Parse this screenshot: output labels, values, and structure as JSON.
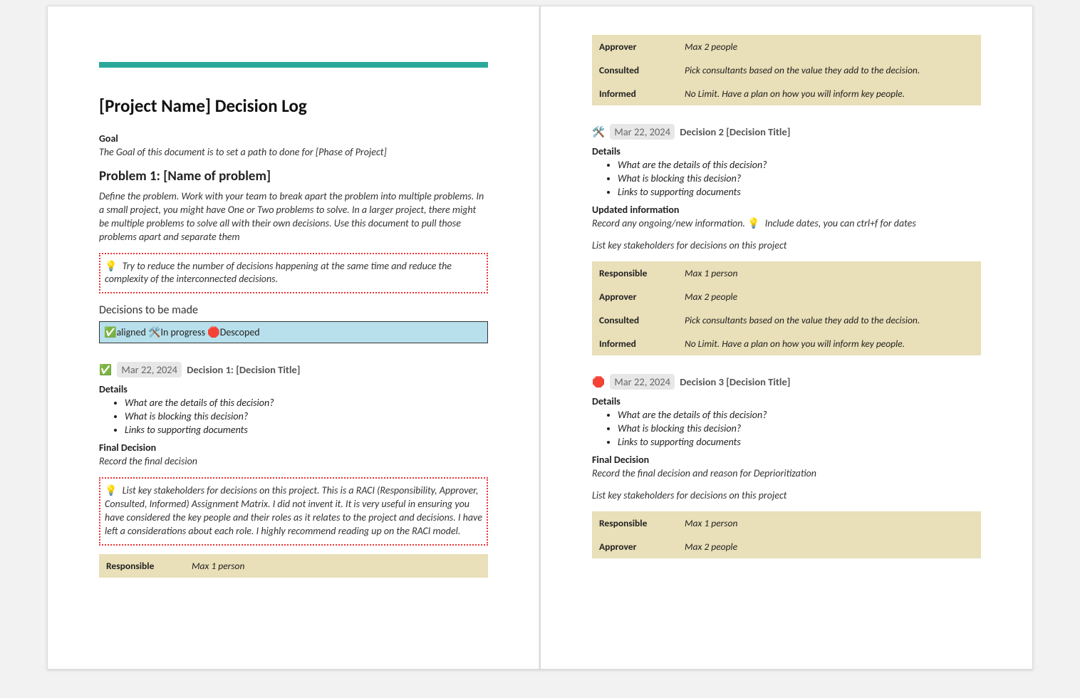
{
  "title": "[Project Name] Decision Log",
  "goal": {
    "heading": "Goal",
    "text": "The Goal of this document is to set a path to done for [Phase of Project]"
  },
  "problem": {
    "heading": "Problem 1: [Name of problem]",
    "text": "Define the problem. Work with your team to break apart the problem into multiple problems. In a small project, you might have One or Two problems to solve. In a larger project, there might be multiple problems to solve all with their own decisions. Use this document to pull those problems apart and separate them"
  },
  "tip1": "Try to reduce the number of decisions happening at the same time and reduce the complexity of the interconnected decisions.",
  "decisions_heading": "Decisions to be made",
  "legend": {
    "aligned": "aligned",
    "inprogress": "In progress",
    "descoped": "Descoped"
  },
  "icons": {
    "check": "✅",
    "tools": "🛠️",
    "stop": "🛑",
    "bulb": "💡"
  },
  "details_heading": "Details",
  "details_items": [
    "What are the details of this decision?",
    "What is blocking this decision?",
    "Links to supporting documents"
  ],
  "final_decision_heading": "Final Decision",
  "updated_info_heading": "Updated information",
  "stakeholders_line": "List key stakeholders for decisions on this project",
  "tip2": "List key stakeholders for decisions on this project. This is a RACI (Responsibility, Approver, Consulted, Informed) Assignment Matrix. I did not invent it. It is very useful in ensuring you have considered the key people and their roles as it relates to the project and decisions. I have left a considerations about each role. I highly recommend reading up on the RACI model.",
  "raci_roles": {
    "responsible": {
      "label": "Responsible",
      "val": "Max 1 person"
    },
    "approver": {
      "label": "Approver",
      "val": "Max 2 people"
    },
    "consulted": {
      "label": "Consulted",
      "val": "Pick consultants based on the value they add to the decision."
    },
    "informed": {
      "label": "Informed",
      "val": "No Limit. Have a plan on how you will inform key people."
    }
  },
  "decisions": {
    "d1": {
      "date": "Mar 22, 2024",
      "title": "Decision 1: [Decision Title]",
      "final_text": "Record the final decision"
    },
    "d2": {
      "date": "Mar 22, 2024",
      "title": "Decision 2 [Decision Title]",
      "updated_text_a": "Record any ongoing/new information.",
      "updated_text_b": "Include dates, you can ctrl+f for dates"
    },
    "d3": {
      "date": "Mar 22, 2024",
      "title": "Decision 3 [Decision Title]",
      "final_text": "Record the final decision and reason for Deprioritization"
    }
  }
}
